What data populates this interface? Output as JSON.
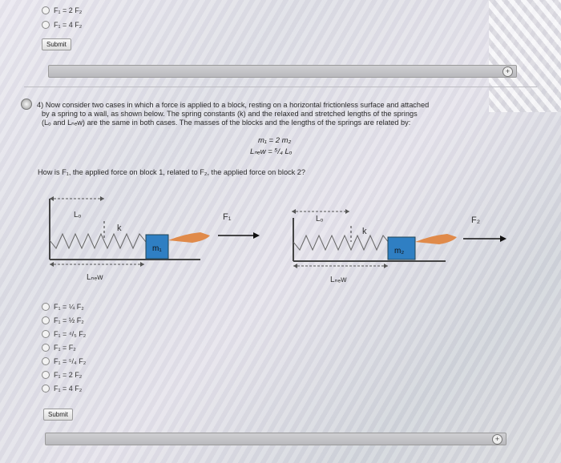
{
  "prev_question": {
    "options": [
      "F₁ = 2 F₂",
      "F₁ = 4 F₂"
    ],
    "submit_label": "Submit"
  },
  "question": {
    "number_text": "4) Now consider two cases in which a force is applied to a block, resting on a horizontal frictionless surface and attached",
    "line2": "by a spring to a wall, as shown below. The spring constants (k) and the relaxed and stretched lengths of the springs",
    "line3": "(Lₒ and Lₙₑw) are the same in both cases. The masses of the blocks and the lengths of the springs are related by:",
    "eq1": "m₁ = 2 m₂",
    "eq2": "Lₙₑw = ⁵/₄ Lₒ",
    "ask": "How is F₁, the applied force on block 1, related to F₂, the applied force on block 2?"
  },
  "figure": {
    "left": {
      "lo": "Lₒ",
      "k": "k",
      "mass": "m₁",
      "force": "F₁",
      "lnew": "Lₙₑw"
    },
    "right": {
      "lo": "Lₒ",
      "k": "k",
      "mass": "m₂",
      "force": "F₂",
      "lnew": "Lₙₑw"
    }
  },
  "options": [
    "F₁ = ¼ F₂",
    "F₁ = ½ F₂",
    "F₁ = ⁴/₅ F₂",
    "F₁ = F₂",
    "F₁ = ⁵/₄ F₂",
    "F₁ = 2 F₂",
    "F₁ = 4 F₂"
  ],
  "submit_label": "Submit"
}
